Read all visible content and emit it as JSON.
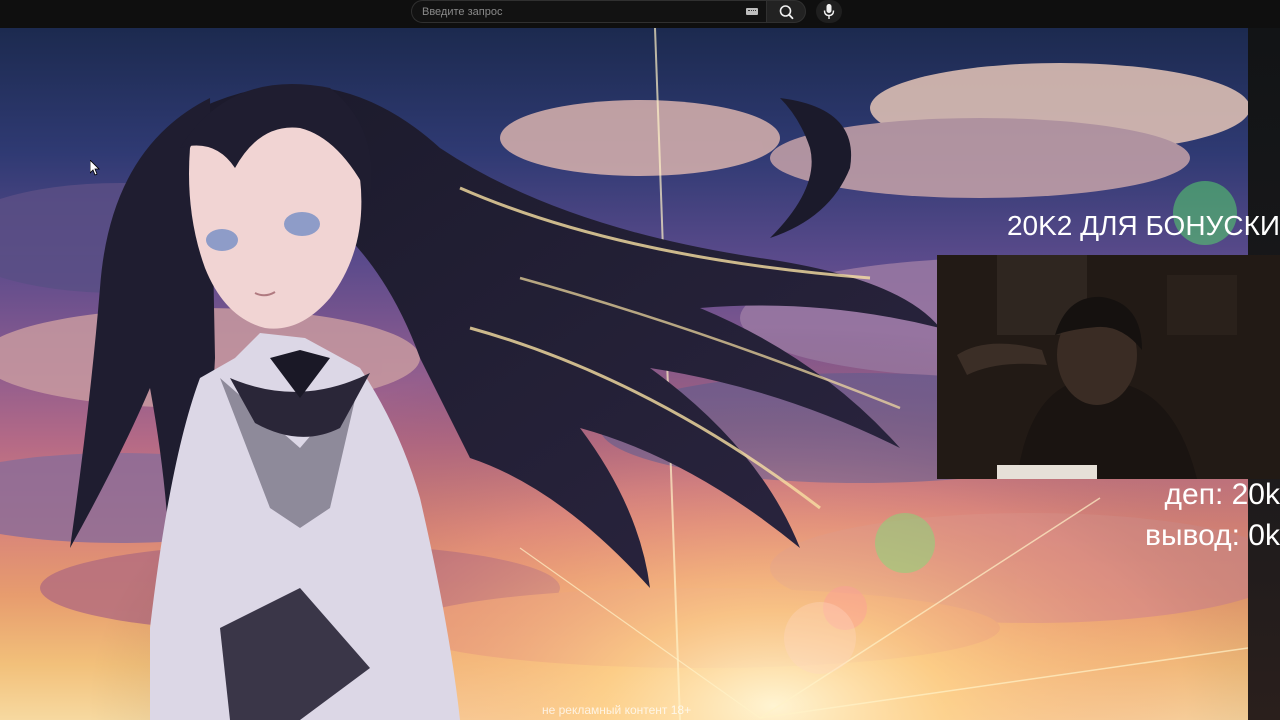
{
  "header": {
    "search": {
      "placeholder": "Введите запрос",
      "value": ""
    },
    "icons": {
      "keyboard": "keyboard-icon",
      "search": "search-icon",
      "mic": "mic-icon"
    }
  },
  "stream_overlay": {
    "title": "20K2 ДЛЯ БОНУСКИ",
    "deposit": "деп: 20k",
    "withdraw": "вывод: 0k"
  },
  "video": {
    "disclaimer": "не рекламный контент 18+"
  },
  "colors": {
    "topbar": "#0f0f0f",
    "overlay_text": "#ffffff"
  }
}
